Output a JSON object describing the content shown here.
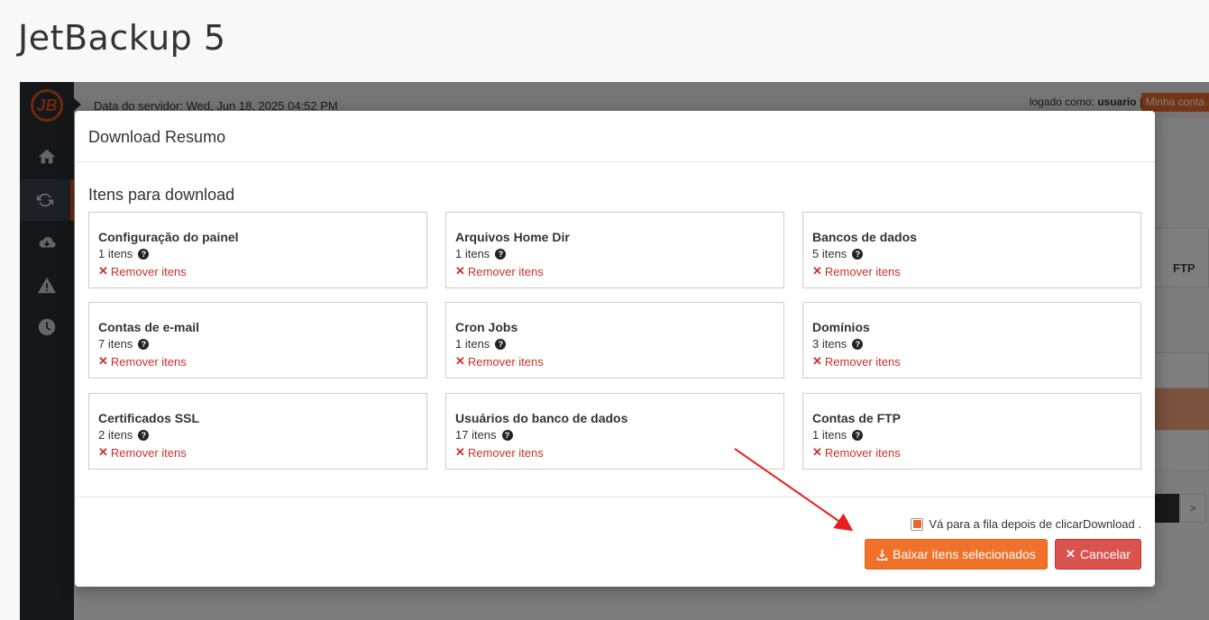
{
  "page": {
    "title": "JetBackup 5"
  },
  "topbar": {
    "server_date": "Data do servidor: Wed, Jun 18, 2025 04:52 PM",
    "logged_prefix": "logado como:",
    "username": "usuario",
    "separator": "|",
    "account_button": "Minha conta"
  },
  "sidebar": {
    "items": [
      {
        "icon": "home-icon"
      },
      {
        "icon": "refresh-icon",
        "active": true
      },
      {
        "icon": "cloud-download-icon"
      },
      {
        "icon": "warning-icon"
      },
      {
        "icon": "clock-icon"
      }
    ]
  },
  "background": {
    "peek_label": "FTP",
    "pager_next": ">"
  },
  "modal": {
    "title": "Download Resumo",
    "section_title": "Itens para download",
    "remove_label": "Remover itens",
    "cards": [
      {
        "name": "Configuração do painel",
        "count": "1 itens"
      },
      {
        "name": "Arquivos Home Dir",
        "count": "1 itens"
      },
      {
        "name": "Bancos de dados",
        "count": "5 itens"
      },
      {
        "name": "Contas de e-mail",
        "count": "7 itens"
      },
      {
        "name": "Cron Jobs",
        "count": "1 itens"
      },
      {
        "name": "Domínios",
        "count": "3 itens"
      },
      {
        "name": "Certificados SSL",
        "count": "2 itens"
      },
      {
        "name": "Usuários do banco de dados",
        "count": "17 itens"
      },
      {
        "name": "Contas de FTP",
        "count": "1 itens"
      }
    ],
    "queue_checkbox": {
      "label": "Vá para a fila depois de clicarDownload .",
      "checked": true
    },
    "download_button": "Baixar itens selecionados",
    "cancel_button": "Cancelar"
  },
  "colors": {
    "accent": "#f0712a",
    "danger": "#d9534f",
    "sidebar": "#2a2f36",
    "annotation_arrow": "#e8201c"
  }
}
